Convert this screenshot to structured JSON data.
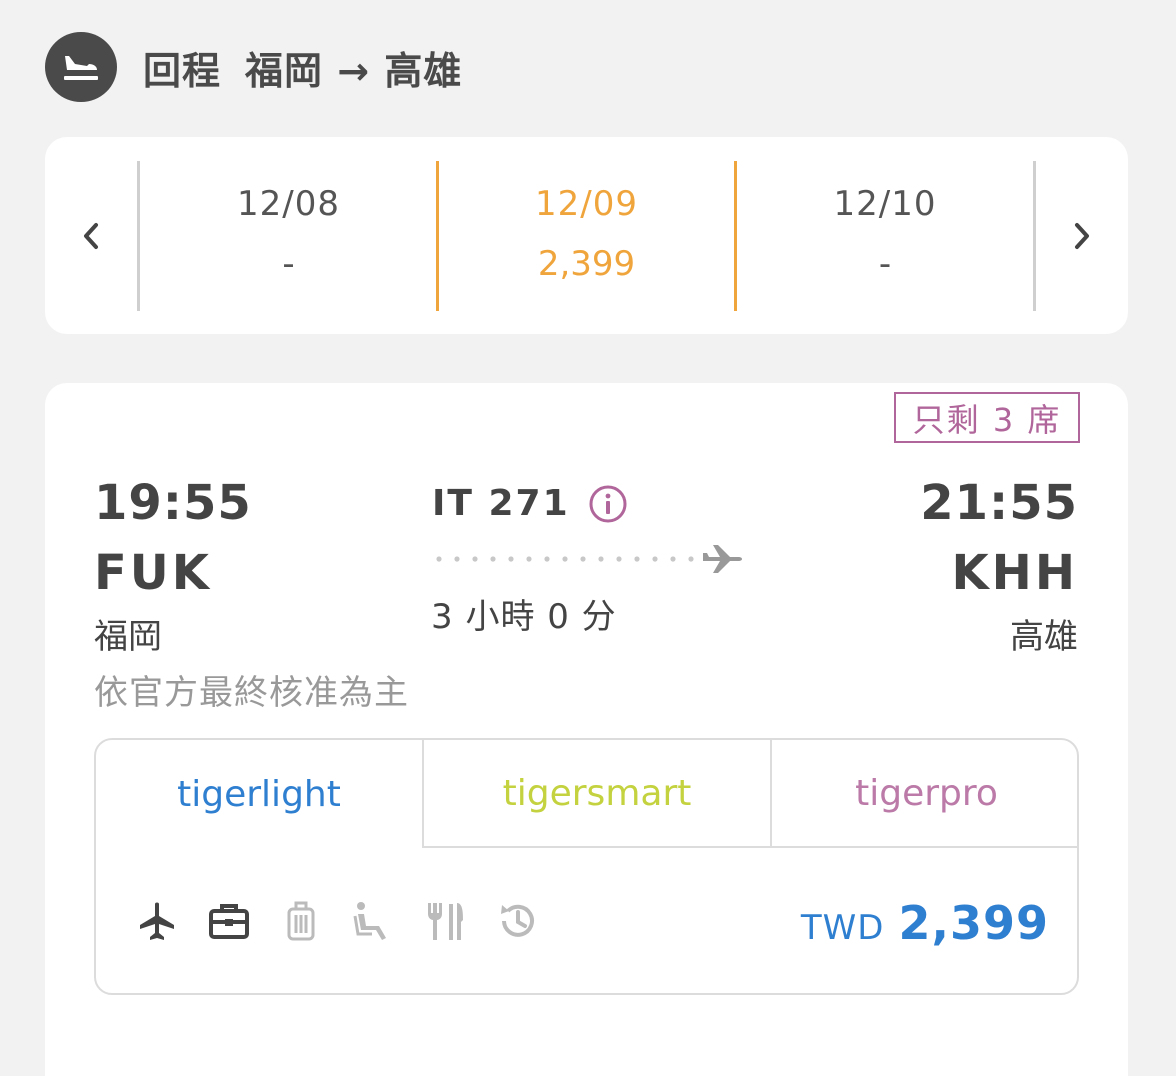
{
  "header": {
    "trip_type": "回程",
    "route": "福岡 → 高雄"
  },
  "dates": [
    {
      "date": "12/08",
      "price": "-"
    },
    {
      "date": "12/09",
      "price": "2,399",
      "active": true
    },
    {
      "date": "12/10",
      "price": "-"
    }
  ],
  "flight": {
    "seats_left": "只剩 3 席",
    "depart_time": "19:55",
    "depart_code": "FUK",
    "depart_city": "福岡",
    "arrive_time": "21:55",
    "arrive_code": "KHH",
    "arrive_city": "高雄",
    "flight_no": "IT 271",
    "duration": "3 小時 0 分",
    "note": "依官方最終核准為主"
  },
  "fares": {
    "tabs": [
      "tigerlight",
      "tigersmart",
      "tigerpro"
    ],
    "currency": "TWD",
    "amount": "2,399",
    "amenity_icons": [
      "plane-icon",
      "briefcase-icon",
      "luggage-icon",
      "seat-icon",
      "meal-icon",
      "history-icon"
    ]
  },
  "colors": {
    "accent_orange": "#f0a53c",
    "light_blue": "#2f7fd1",
    "smart_green": "#c3d23e",
    "pro_purple": "#bb7aa8",
    "badge_purple": "#b0669a"
  }
}
